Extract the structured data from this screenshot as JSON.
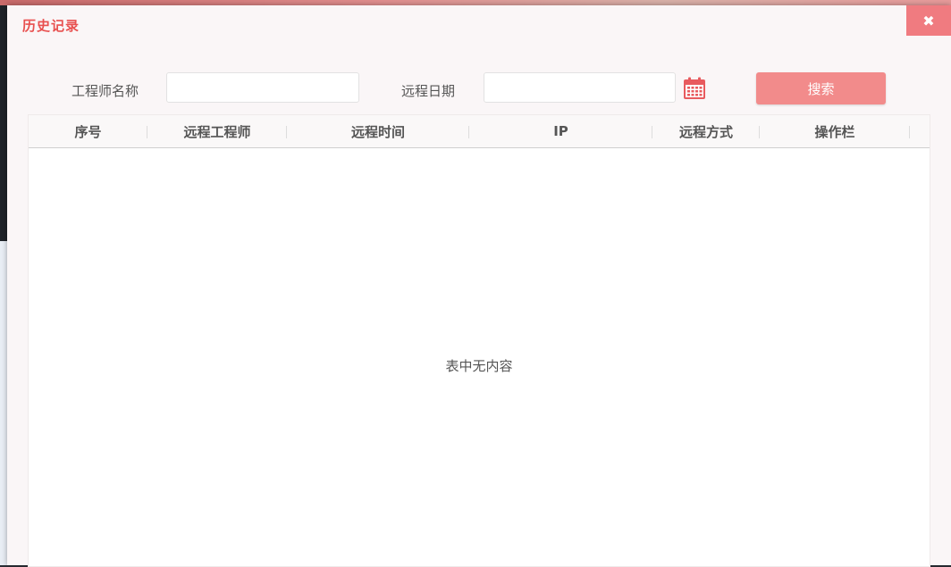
{
  "dialog": {
    "title": "历史记录",
    "close_label": "✖"
  },
  "filters": {
    "engineer_name_label": "工程师名称",
    "engineer_name_value": "",
    "remote_date_label": "远程日期",
    "remote_date_value": "",
    "search_label": "搜索"
  },
  "table": {
    "columns": [
      "序号",
      "远程工程师",
      "远程时间",
      "IP",
      "远程方式",
      "操作栏"
    ],
    "rows": [],
    "empty_text": "表中无内容"
  },
  "colors": {
    "accent": "#e8504f",
    "button": "#f28b8b",
    "close_button": "#f07b80",
    "calendar_icon": "#e85a5e"
  }
}
